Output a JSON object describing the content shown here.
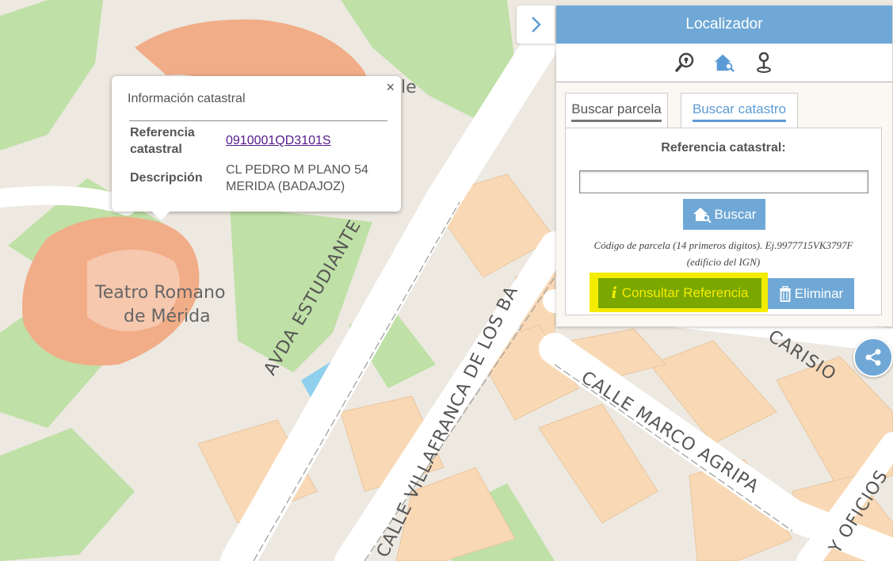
{
  "map": {
    "streets": [
      "AVDA ESTUDIANTE",
      "CALLE VILLAFRANCA DE LOS BA",
      "CALLE MARCO AGRIPA",
      "CARISIO",
      "Y OFICIOS"
    ],
    "places": [
      "Teatro Romano",
      "de Mérida"
    ],
    "fragment": "le"
  },
  "popup": {
    "title": "Información catastral",
    "close_icon": "×",
    "ref_label_1": "Referencia",
    "ref_label_2": "catastral",
    "ref_value": "0910001QD3101S",
    "desc_label": "Descripción",
    "desc_line1": "CL PEDRO M PLANO 54",
    "desc_line2": "MERIDA (BADAJOZ)"
  },
  "panel": {
    "title": "Localizador",
    "icons": [
      "search-location-icon",
      "house-search-icon",
      "pin-icon"
    ],
    "tabs": [
      {
        "label": "Buscar parcela"
      },
      {
        "label": "Buscar catastro"
      }
    ],
    "ref_label": "Referencia catastral:",
    "input_value": "",
    "search_button": "Buscar",
    "hint_line1": "Código de parcela (14 primeros digitos). Ej.9977715VK3797F",
    "hint_line2": "(edificio del IGN)",
    "consult_button": "Consultar Referencia",
    "delete_button": "Eliminar"
  },
  "colors": {
    "accent": "#6fa8d6",
    "highlight": "#f4ec00",
    "consult_bg": "#7aa800"
  }
}
